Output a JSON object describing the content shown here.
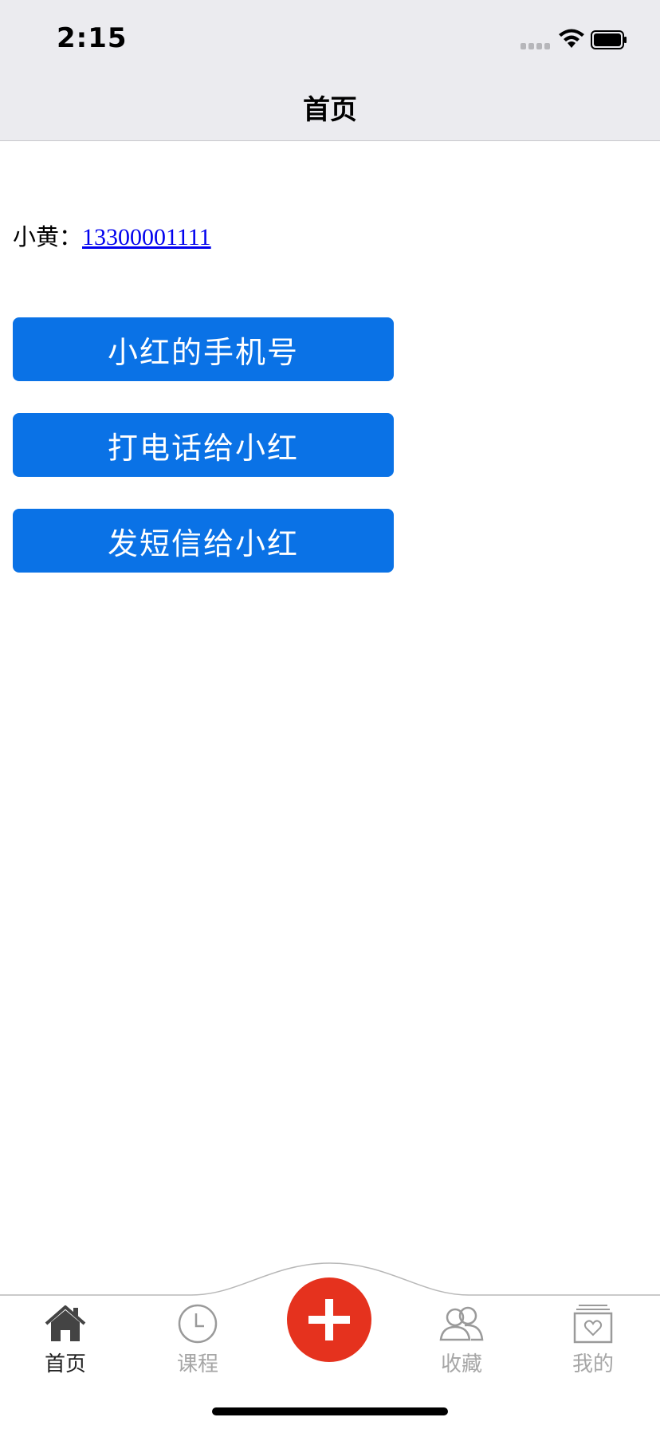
{
  "status_bar": {
    "time": "2:15"
  },
  "nav": {
    "title": "首页"
  },
  "contact": {
    "name_label": "小黄：",
    "phone": "13300001111"
  },
  "buttons": {
    "phone_number": "小红的手机号",
    "call": "打电话给小红",
    "sms": "发短信给小红"
  },
  "tabbar": {
    "items": [
      {
        "label": "首页",
        "icon": "home-icon",
        "active": true
      },
      {
        "label": "课程",
        "icon": "clock-icon",
        "active": false
      },
      {
        "label": "收藏",
        "icon": "people-icon",
        "active": false
      },
      {
        "label": "我的",
        "icon": "heart-box-icon",
        "active": false
      }
    ],
    "center_icon": "plus-icon"
  },
  "colors": {
    "button": "#0a72e6",
    "add_button": "#e5321e",
    "link": "#0000ee",
    "header_bg": "#ebebef"
  }
}
